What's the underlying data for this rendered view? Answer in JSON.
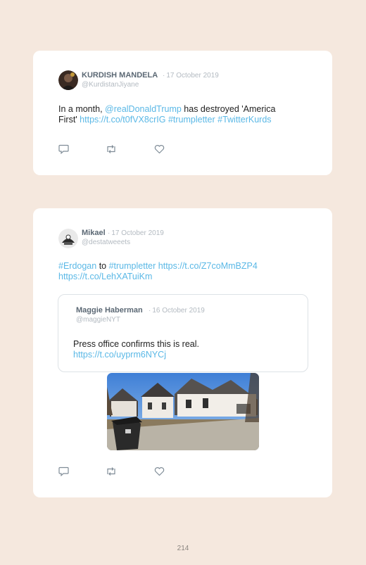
{
  "tweets": [
    {
      "author_name": "KURDISH MANDELA",
      "separator": "·",
      "date": "17 October 2019",
      "handle": "@KurdistanJiyane",
      "text_line1": {
        "pre": "In a month, ",
        "mention": "@realDonaldTrump",
        "post": " has destroyed 'America"
      },
      "text_line2": {
        "pre": "First' ",
        "link": "https://t.co/t0fVX8crIG",
        "hashtag1": "#trumpletter",
        "hashtag2": "#TwitterKurds"
      }
    },
    {
      "author_name": "Mikael",
      "separator": "·",
      "date": "17 October 2019",
      "handle": "@destatweeets",
      "text_line1": {
        "hashtag1": "#Erdogan",
        "mid": " to ",
        "hashtag2": "#trumpletter",
        "link": "https://t.co/Z7coMmBZP4"
      },
      "text_line2": {
        "link": "https://t.co/LehXATuiKm"
      },
      "quoted": {
        "author_name": "Maggie Haberman",
        "separator": "·",
        "date": "16 October 2019",
        "handle": "@maggieNYT",
        "text": "Press office confirms this is real.",
        "link": "https://t.co/uyprm6NYCj"
      }
    }
  ],
  "icons": [
    "reply-icon",
    "retweet-icon",
    "like-icon"
  ],
  "page_number": "214",
  "colors": {
    "background": "#f5e8de",
    "card": "#ffffff",
    "link": "#5ab8e6",
    "name": "#5b6874",
    "meta": "#b3bac1"
  }
}
